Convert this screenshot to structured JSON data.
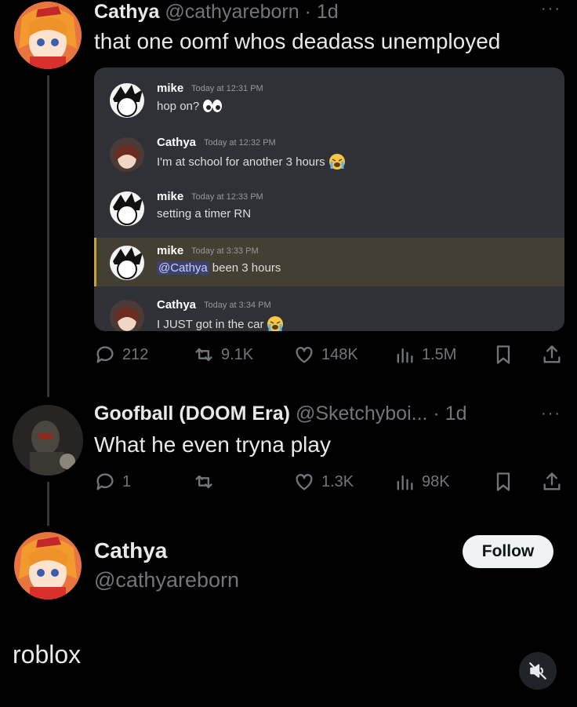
{
  "tweet1": {
    "name": "Cathya",
    "handle_time": "@cathyareborn · 1d",
    "text": "that one oomf whos deadass unemployed",
    "more": "···",
    "discord": [
      {
        "name": "mike",
        "time": "Today at 12:31 PM",
        "text": "hop on?",
        "emoji": "eyes"
      },
      {
        "name": "Cathya",
        "time": "Today at 12:32 PM",
        "text": "I'm at school for another 3 hours",
        "emoji": "crying"
      },
      {
        "name": "mike",
        "time": "Today at 12:33 PM",
        "text": "setting a timer RN",
        "emoji": ""
      },
      {
        "name": "mike",
        "time": "Today at 3:33 PM",
        "mention": "@Cathya",
        "text": "been 3 hours",
        "emoji": ""
      },
      {
        "name": "Cathya",
        "time": "Today at 3:34 PM",
        "text": "I JUST got in the car",
        "emoji": "crying"
      }
    ],
    "actions": {
      "replies": "212",
      "reposts": "9.1K",
      "likes": "148K",
      "views": "1.5M"
    }
  },
  "tweet2": {
    "name": "Goofball (DOOM Era)",
    "handle_time": "@Sketchyboi... · 1d",
    "text": "What he even tryna play",
    "more": "···",
    "actions": {
      "replies": "1",
      "reposts": "",
      "likes": "1.3K",
      "views": "98K"
    }
  },
  "profile": {
    "name": "Cathya",
    "handle": "@cathyareborn",
    "follow_label": "Follow"
  },
  "caption": "roblox",
  "colors": {
    "background": "#000000",
    "text": "#e7e9ea",
    "muted": "#71767b",
    "discord_bg": "#2f3136",
    "highlight": "#443f33"
  }
}
